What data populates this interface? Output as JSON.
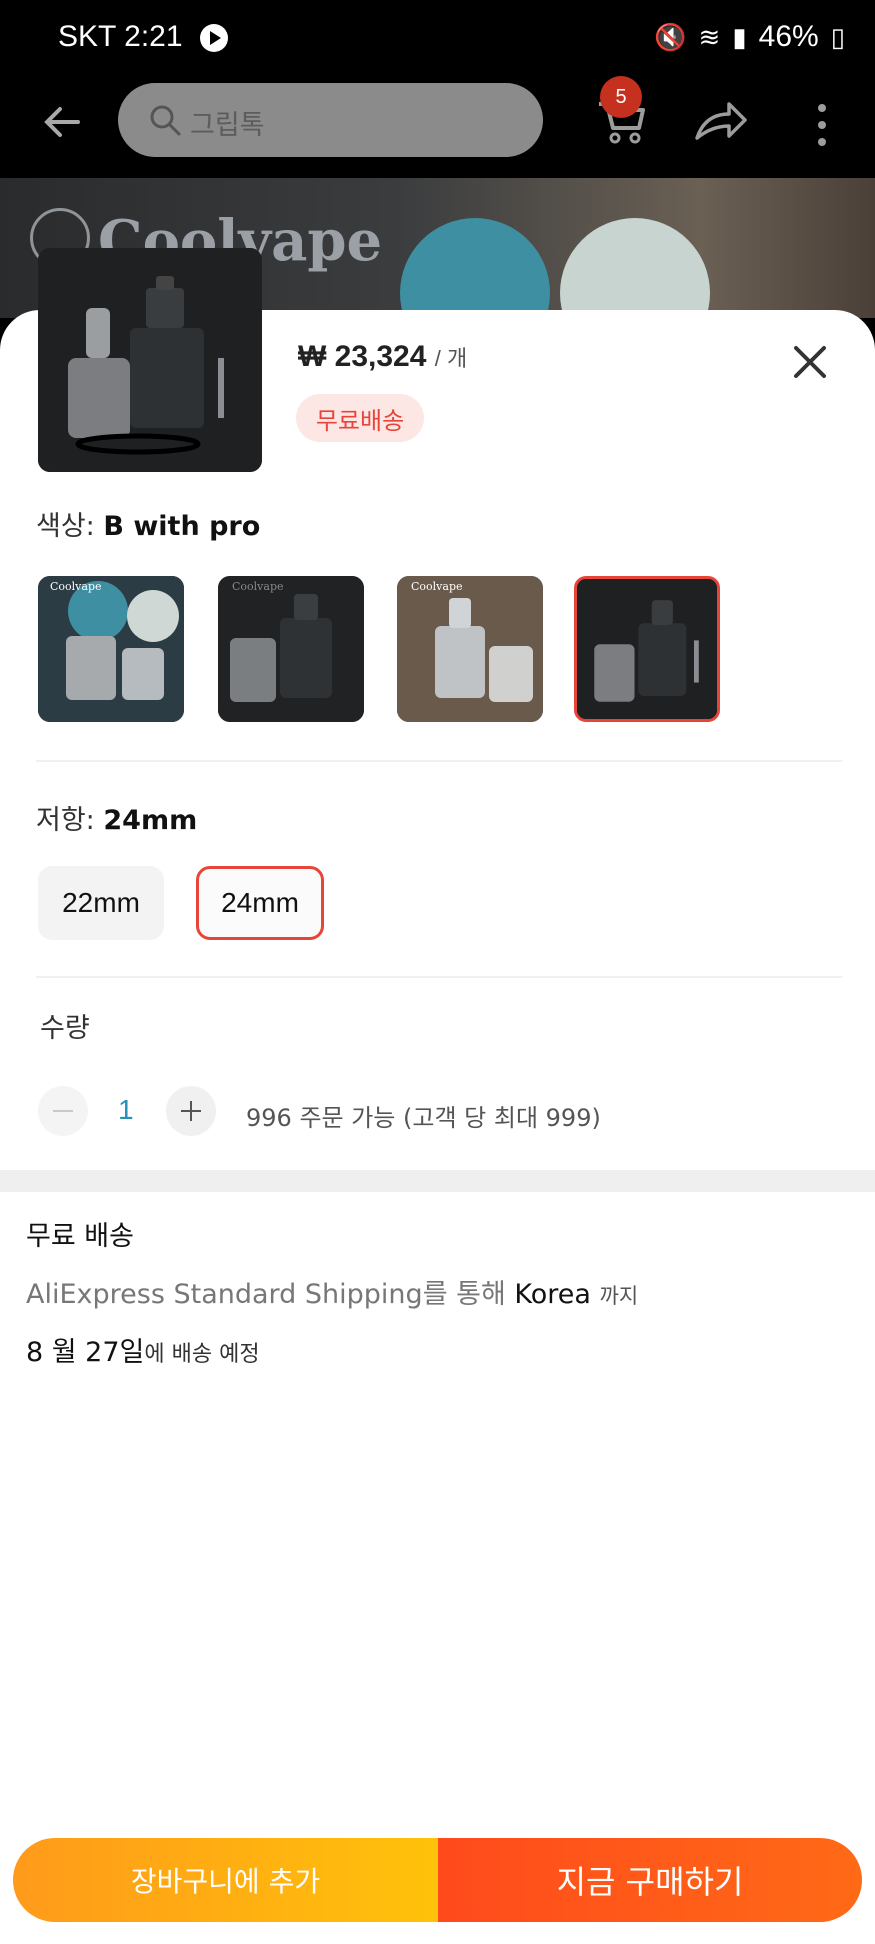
{
  "status_bar": {
    "carrier_time": "SKT 2:21",
    "battery": "46%",
    "icons": [
      "mute-icon",
      "wifi-icon",
      "signal-icon",
      "battery-icon"
    ]
  },
  "header": {
    "search_placeholder": "그립톡",
    "cart_badge": "5",
    "icons": [
      "back-arrow-icon",
      "search-icon",
      "cart-icon",
      "share-icon",
      "more-vertical-icon"
    ]
  },
  "hero": {
    "brand": "Coolvape"
  },
  "sheet": {
    "price": "₩ 23,324",
    "price_unit": "/ 개",
    "free_shipping_badge": "무료배송",
    "color": {
      "label": "색상:",
      "selected": "B with pro",
      "swatches": [
        {
          "name": "color-option-1",
          "brand": "Coolvape"
        },
        {
          "name": "color-option-2",
          "brand": "Coolvape"
        },
        {
          "name": "color-option-3",
          "brand": "Coolvape"
        },
        {
          "name": "color-option-4",
          "brand": ""
        }
      ],
      "selected_index": 3
    },
    "resistance": {
      "label": "저항:",
      "selected": "24mm",
      "options": [
        "22mm",
        "24mm"
      ]
    },
    "quantity": {
      "label": "수량",
      "value": "1",
      "note": "996 주문 가능 (고객 당 최대 999)"
    },
    "shipping": {
      "title": "무료 배송",
      "method": "AliExpress Standard Shipping",
      "method_suffix": "를 통해",
      "destination": "Korea",
      "destination_suffix": "까지",
      "date": "8 월 27일",
      "date_suffix": "에 배송 예정"
    },
    "actions": {
      "add_to_cart": "장바구니에 추가",
      "buy_now": "지금 구매하기"
    }
  },
  "colors": {
    "accent": "#e8453a",
    "cart_gradient": [
      "#ff9a1a",
      "#ffc20a"
    ],
    "buy_gradient": [
      "#ff4a1c",
      "#ff6a16"
    ]
  }
}
